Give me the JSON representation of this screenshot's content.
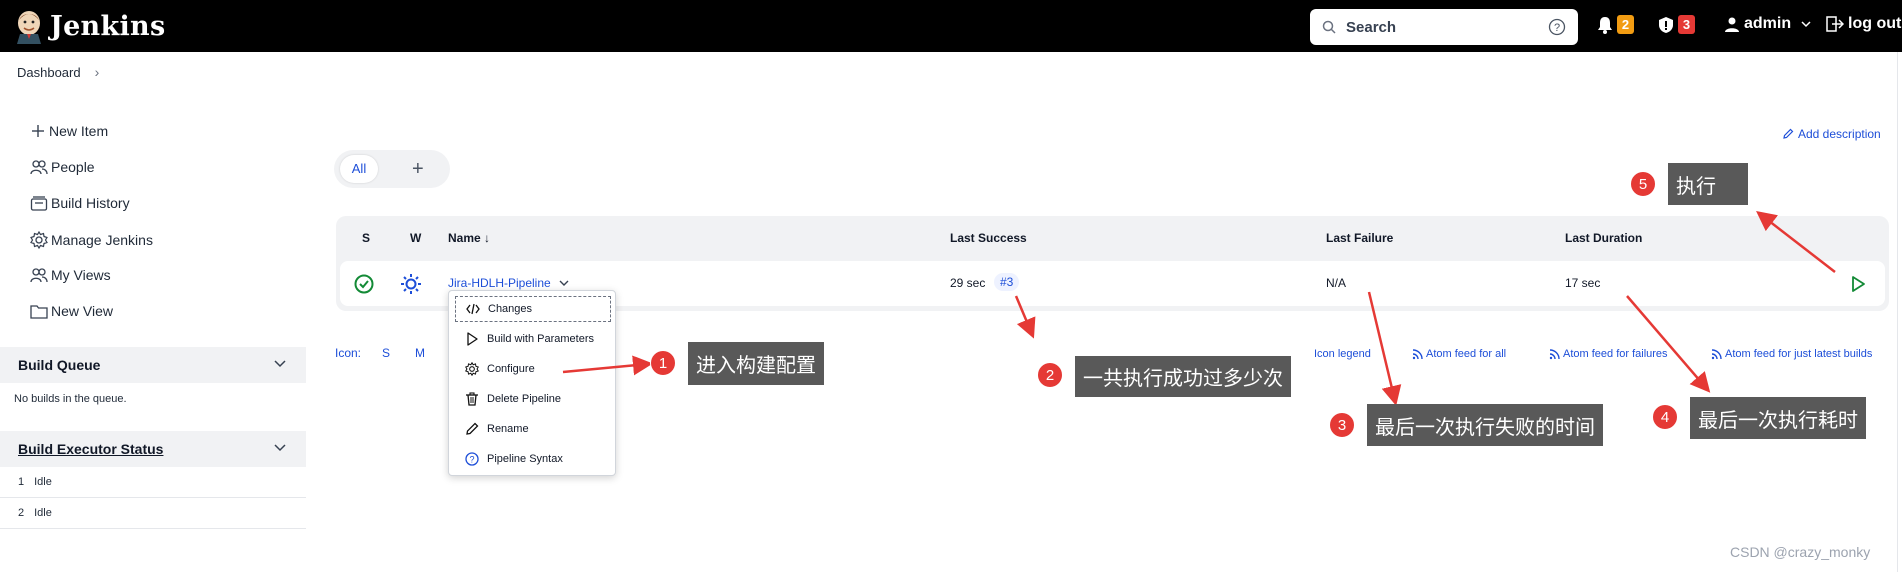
{
  "header": {
    "app_name": "Jenkins",
    "search_placeholder": "Search",
    "notifications_count": "2",
    "security_count": "3",
    "user_name": "admin",
    "logout_label": "log out",
    "colors": {
      "background": "#000000",
      "notify_badge": "#f29c12",
      "security_badge": "#e53935"
    }
  },
  "breadcrumb": {
    "items": [
      "Dashboard"
    ],
    "separator": "›"
  },
  "sidebar": {
    "items": [
      {
        "label": "New Item",
        "icon": "plus-icon"
      },
      {
        "label": "People",
        "icon": "people-icon"
      },
      {
        "label": "Build History",
        "icon": "build-history-icon"
      },
      {
        "label": "Manage Jenkins",
        "icon": "gear-icon"
      },
      {
        "label": "My Views",
        "icon": "people-icon"
      },
      {
        "label": "New View",
        "icon": "folder-icon"
      }
    ],
    "build_queue": {
      "title": "Build Queue",
      "empty_text": "No builds in the queue."
    },
    "executor_status": {
      "title": "Build Executor Status",
      "executors": [
        {
          "number": "1",
          "state": "Idle"
        },
        {
          "number": "2",
          "state": "Idle"
        }
      ]
    }
  },
  "main": {
    "add_description_label": "Add description",
    "tabs": [
      {
        "label": "All",
        "active": true
      },
      {
        "label": "+"
      }
    ],
    "table": {
      "headers": {
        "s": "S",
        "w": "W",
        "name": "Name ↓",
        "last_success": "Last Success",
        "last_failure": "Last Failure",
        "last_duration": "Last Duration"
      },
      "rows": [
        {
          "name": "Jira-HDLH-Pipeline",
          "last_success": "29 sec",
          "last_success_build": "#3",
          "last_failure": "N/A",
          "last_duration": "17 sec",
          "status": "success",
          "weather": "sunny"
        }
      ]
    },
    "icon_legend": {
      "label": "Icon:",
      "sizes": [
        "S",
        "M"
      ],
      "legend_link": "Icon legend"
    },
    "feeds": [
      "Atom feed for all",
      "Atom feed for failures",
      "Atom feed for just latest builds"
    ]
  },
  "context_menu": {
    "items": [
      {
        "label": "Changes",
        "icon": "code-icon",
        "focused": true
      },
      {
        "label": "Build with Parameters",
        "icon": "play-icon"
      },
      {
        "label": "Configure",
        "icon": "gear-icon"
      },
      {
        "label": "Delete Pipeline",
        "icon": "trash-icon"
      },
      {
        "label": "Rename",
        "icon": "pencil-icon"
      },
      {
        "label": "Pipeline Syntax",
        "icon": "help-icon"
      }
    ]
  },
  "annotations": [
    {
      "number": "1",
      "text": "进入构建配置"
    },
    {
      "number": "2",
      "text": "一共执行成功过多少次"
    },
    {
      "number": "3",
      "text": "最后一次执行失败的时间"
    },
    {
      "number": "4",
      "text": "最后一次执行耗时"
    },
    {
      "number": "5",
      "text": "执行"
    }
  ],
  "watermark": "CSDN @crazy_monky"
}
